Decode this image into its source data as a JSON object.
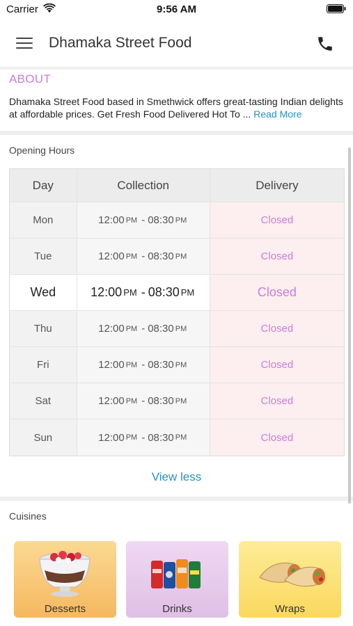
{
  "status_bar": {
    "carrier": "Carrier",
    "time": "9:56 AM"
  },
  "header": {
    "title": "Dhamaka Street Food"
  },
  "about": {
    "heading": "ABOUT",
    "text": "Dhamaka Street Food based in Smethwick offers great-tasting Indian delights at affordable prices. Get Fresh Food Delivered Hot To ...",
    "read_more": "Read More"
  },
  "opening_hours": {
    "title": "Opening Hours",
    "headers": {
      "day": "Day",
      "collection": "Collection",
      "delivery": "Delivery"
    },
    "rows": [
      {
        "day": "Mon",
        "open": "12:00",
        "close": "08:30",
        "delivery": "Closed"
      },
      {
        "day": "Tue",
        "open": "12:00",
        "close": "08:30",
        "delivery": "Closed"
      },
      {
        "day": "Wed",
        "open": "12:00",
        "close": "08:30",
        "delivery": "Closed"
      },
      {
        "day": "Thu",
        "open": "12:00",
        "close": "08:30",
        "delivery": "Closed"
      },
      {
        "day": "Fri",
        "open": "12:00",
        "close": "08:30",
        "delivery": "Closed"
      },
      {
        "day": "Sat",
        "open": "12:00",
        "close": "08:30",
        "delivery": "Closed"
      },
      {
        "day": "Sun",
        "open": "12:00",
        "close": "08:30",
        "delivery": "Closed"
      }
    ],
    "pm": "PM",
    "separator": "-",
    "view_less": "View less"
  },
  "cuisines": {
    "title": "Cuisines",
    "items": [
      {
        "label": "Desserts",
        "icon": "dessert-cup-icon"
      },
      {
        "label": "Drinks",
        "icon": "soda-cans-icon"
      },
      {
        "label": "Wraps",
        "icon": "wrap-icon"
      }
    ]
  },
  "colors": {
    "accent_purple": "#c87fd8",
    "link_blue": "#2a8fc4",
    "closed_bg": "#fdeef0"
  }
}
